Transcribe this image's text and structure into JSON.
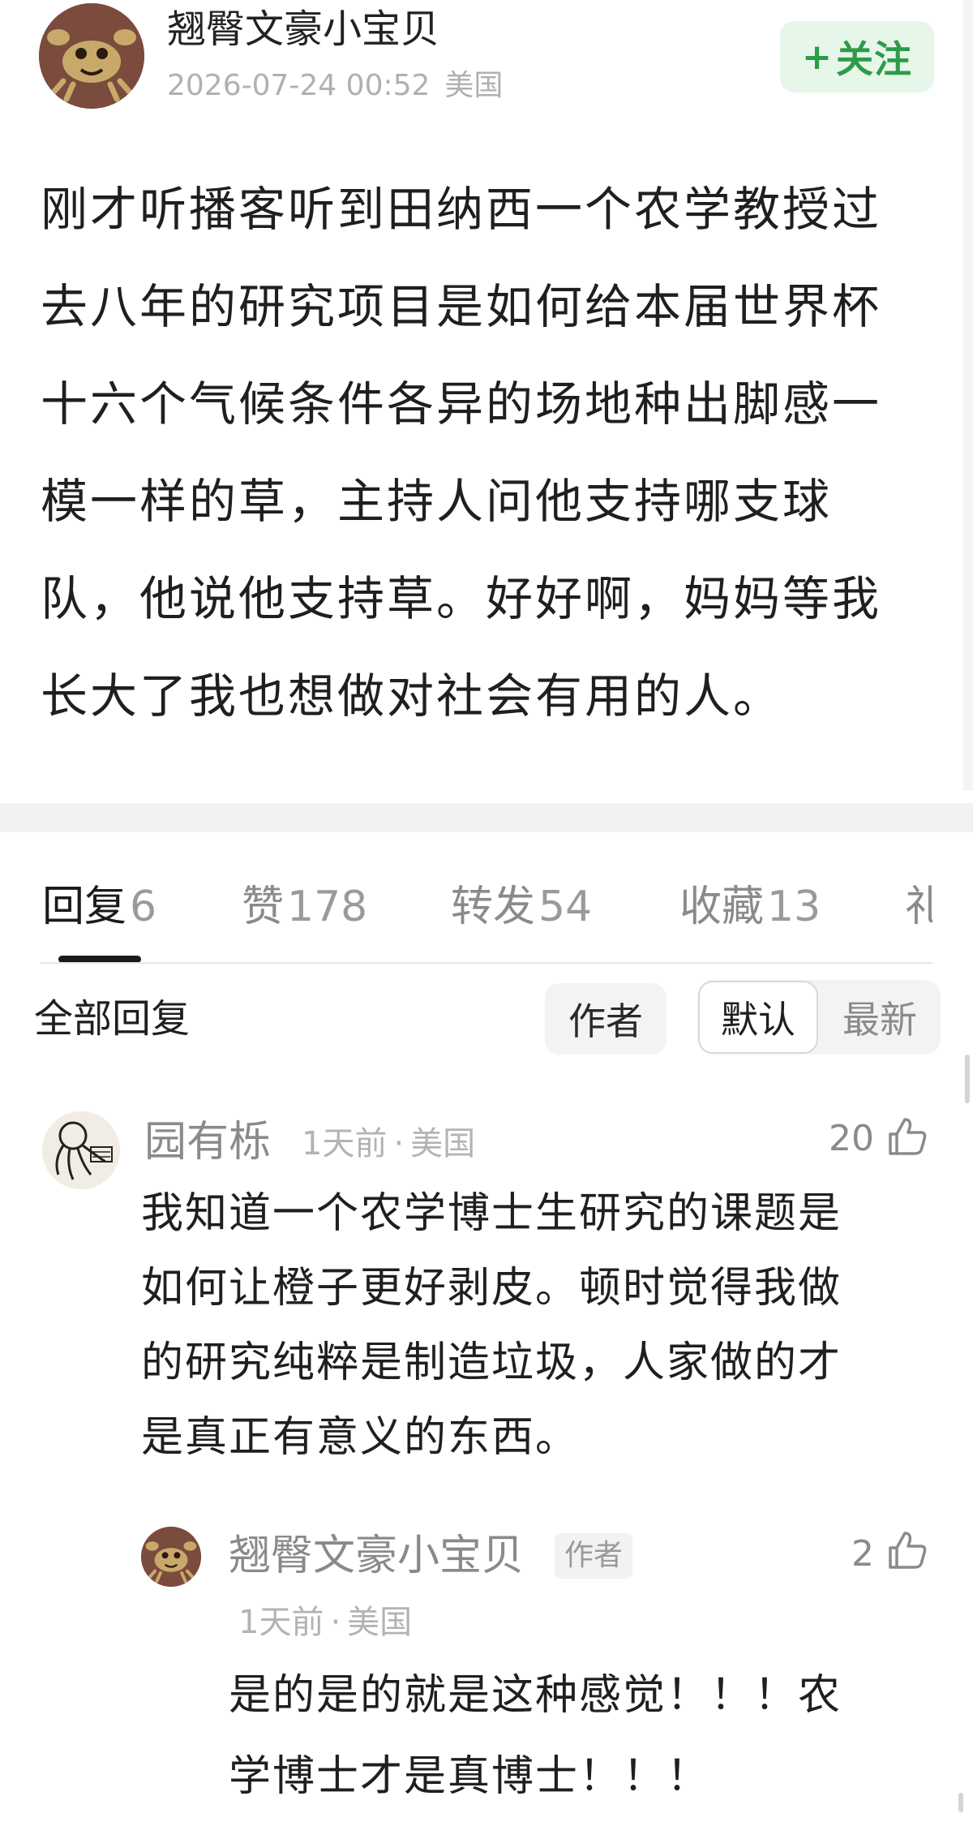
{
  "post": {
    "author": "翘臀文豪小宝贝",
    "datetime": "2026-07-24 00:52",
    "location": "美国",
    "follow_label": "关注",
    "follow_plus": "+",
    "body": "刚才听播客听到田纳西一个农学教授过\n去八年的研究项目是如何给本届世界杯\n十六个气候条件各异的场地种出脚感一\n模一样的草，主持人问他支持哪支球\n队，他说他支持草。好好啊，妈妈等我\n长大了我也想做对社会有用的人。"
  },
  "tabs": [
    {
      "label": "回复",
      "count": "6"
    },
    {
      "label": "赞",
      "count": "178"
    },
    {
      "label": "转发",
      "count": "54"
    },
    {
      "label": "收藏",
      "count": "13"
    },
    {
      "label": "礼",
      "count": ""
    }
  ],
  "filters": {
    "all_replies": "全部回复",
    "author": "作者",
    "default": "默认",
    "latest": "最新"
  },
  "comments": [
    {
      "name": "园有栎",
      "time": "1天前",
      "location": "美国",
      "likes": "20",
      "body": "我知道一个农学博士生研究的课题是\n如何让橙子更好剥皮。顿时觉得我做\n的研究纯粹是制造垃圾，人家做的才\n是真正有意义的东西。"
    }
  ],
  "reply": {
    "name": "翘臀文豪小宝贝",
    "badge": "作者",
    "time": "1天前",
    "location": "美国",
    "likes": "2",
    "body": "是的是的就是这种感觉！！！农\n学博士才是真博士！！！"
  },
  "colors": {
    "follow_bg": "#e6f6e9",
    "follow_text": "#2e9b47",
    "meta_gray": "#b0b0b0"
  }
}
